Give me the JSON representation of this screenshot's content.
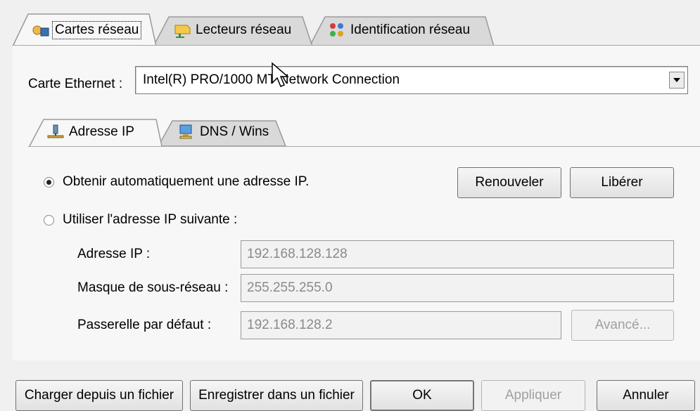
{
  "outer_tabs": [
    {
      "label": "Cartes réseau",
      "icon": "network-cards-icon",
      "active": true
    },
    {
      "label": "Lecteurs réseau",
      "icon": "network-drive-icon",
      "active": false
    },
    {
      "label": "Identification réseau",
      "icon": "network-identity-icon",
      "active": false
    }
  ],
  "ethernet": {
    "label": "Carte Ethernet :",
    "selected": "Intel(R) PRO/1000 MT Network Connection"
  },
  "inner_tabs": [
    {
      "label": "Adresse IP",
      "icon": "ip-network-icon",
      "active": true
    },
    {
      "label": "DNS / Wins",
      "icon": "dns-computer-icon",
      "active": false
    }
  ],
  "ip_mode": {
    "auto_label": "Obtenir automatiquement une adresse IP.",
    "manual_label": "Utiliser l'adresse IP suivante :",
    "selected": "auto"
  },
  "buttons": {
    "renew": "Renouveler",
    "release": "Libérer",
    "advanced": "Avancé...",
    "load": "Charger depuis un fichier",
    "save": "Enregistrer dans un fichier",
    "ok": "OK",
    "apply": "Appliquer",
    "cancel": "Annuler"
  },
  "fields": {
    "ip_label": "Adresse IP :",
    "ip_value": "192.168.128.128",
    "mask_label": "Masque de sous-réseau :",
    "mask_value": "255.255.255.0",
    "gateway_label": "Passerelle par défaut :",
    "gateway_value": "192.168.128.2"
  },
  "colors": {
    "background": "#f0f0f0",
    "disabled_text": "#a0a0a0",
    "border": "#707070"
  }
}
